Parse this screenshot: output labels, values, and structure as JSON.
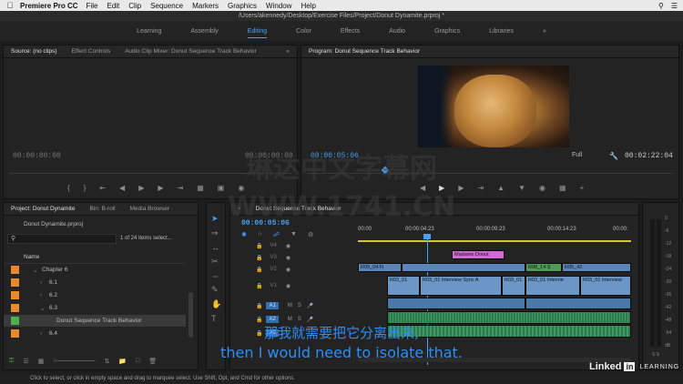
{
  "menubar": {
    "app_name": "Premiere Pro CC",
    "items": [
      "File",
      "Edit",
      "Clip",
      "Sequence",
      "Markers",
      "Graphics",
      "Window",
      "Help"
    ]
  },
  "titlebar": {
    "path": "/Users/akennedy/Desktop/Exercise Files/Project/Donut Dynamite.prproj *"
  },
  "workspaces": {
    "items": [
      "Learning",
      "Assembly",
      "Editing",
      "Color",
      "Effects",
      "Audio",
      "Graphics",
      "Libraries"
    ],
    "active": "Editing",
    "more": "»"
  },
  "source": {
    "tabs": [
      "Source: (no clips)",
      "Effect Controls",
      "Audio Clip Mixer: Donut Sequence Track Behavior"
    ],
    "timecode_left": "00:00:00:00",
    "timecode_right": "00:00:00:00"
  },
  "program": {
    "tab": "Program: Donut Sequence Track Behavior",
    "timecode": "00:00:05:06",
    "fit": "Full",
    "duration": "00:02:22:04"
  },
  "project": {
    "tabs": [
      "Project: Donut Dynamite",
      "Bin: B-roll",
      "Media Browser"
    ],
    "file": "Donut Dynamite.prproj",
    "items_selected": "1 of 24 items select...",
    "column_header": "Name",
    "rows": [
      {
        "label": "Chapter 6",
        "indent": 1,
        "color": "#e8892c"
      },
      {
        "label": "6.1",
        "indent": 2,
        "color": "#e8892c"
      },
      {
        "label": "6.2",
        "indent": 2,
        "color": "#e8892c"
      },
      {
        "label": "6.3",
        "indent": 2,
        "color": "#e8892c"
      },
      {
        "label": "Donut Sequence Track Behavior",
        "indent": 3,
        "color": "#4fae4f"
      },
      {
        "label": "6.4",
        "indent": 2,
        "color": "#e8892c"
      }
    ]
  },
  "timeline": {
    "tab": "Donut Sequence Track Behavior",
    "timecode": "00:00:05:06",
    "ruler": [
      "00:00",
      "00:00:04:23",
      "00:00:09:23",
      "00:00:14:23",
      "00:00:"
    ],
    "video_tracks": [
      "V4",
      "V3",
      "V2",
      "V1"
    ],
    "audio_tracks": [
      "A1",
      "A2",
      "A3"
    ],
    "clips": {
      "madame": "Madame Donut",
      "r09": "R09_04 Fi",
      "r08": "R08_14 S",
      "r05": "R05_42",
      "r03a": "R03_01",
      "r03b": "R03_01 Interview Sync A",
      "r03c": "R03_01",
      "r03d": "R03_01 Intervie",
      "r03e": "R03_01 Interview"
    }
  },
  "meters": {
    "labels": [
      "0",
      "-6",
      "-12",
      "-18",
      "-24",
      "-30",
      "-36",
      "-42",
      "-48",
      "-54",
      "dB"
    ],
    "solo": "S S"
  },
  "subtitles": {
    "chinese": "那我就需要把它分离出来,",
    "english": "then I would need to isolate that."
  },
  "watermark": {
    "line1": "琳达中文字幕网",
    "line2": "WWW.1741.CN"
  },
  "branding": {
    "logo": "Linked",
    "logo_in": "in",
    "learning": "LEARNING"
  },
  "status": {
    "text": "Click to select, or click in empty space and drag to marquee select. Use Shift, Opt, and Cmd for other options."
  },
  "colors": {
    "accent": "#4aa0f5",
    "bin_orange": "#e8892c",
    "sequence_green": "#4fae4f"
  }
}
